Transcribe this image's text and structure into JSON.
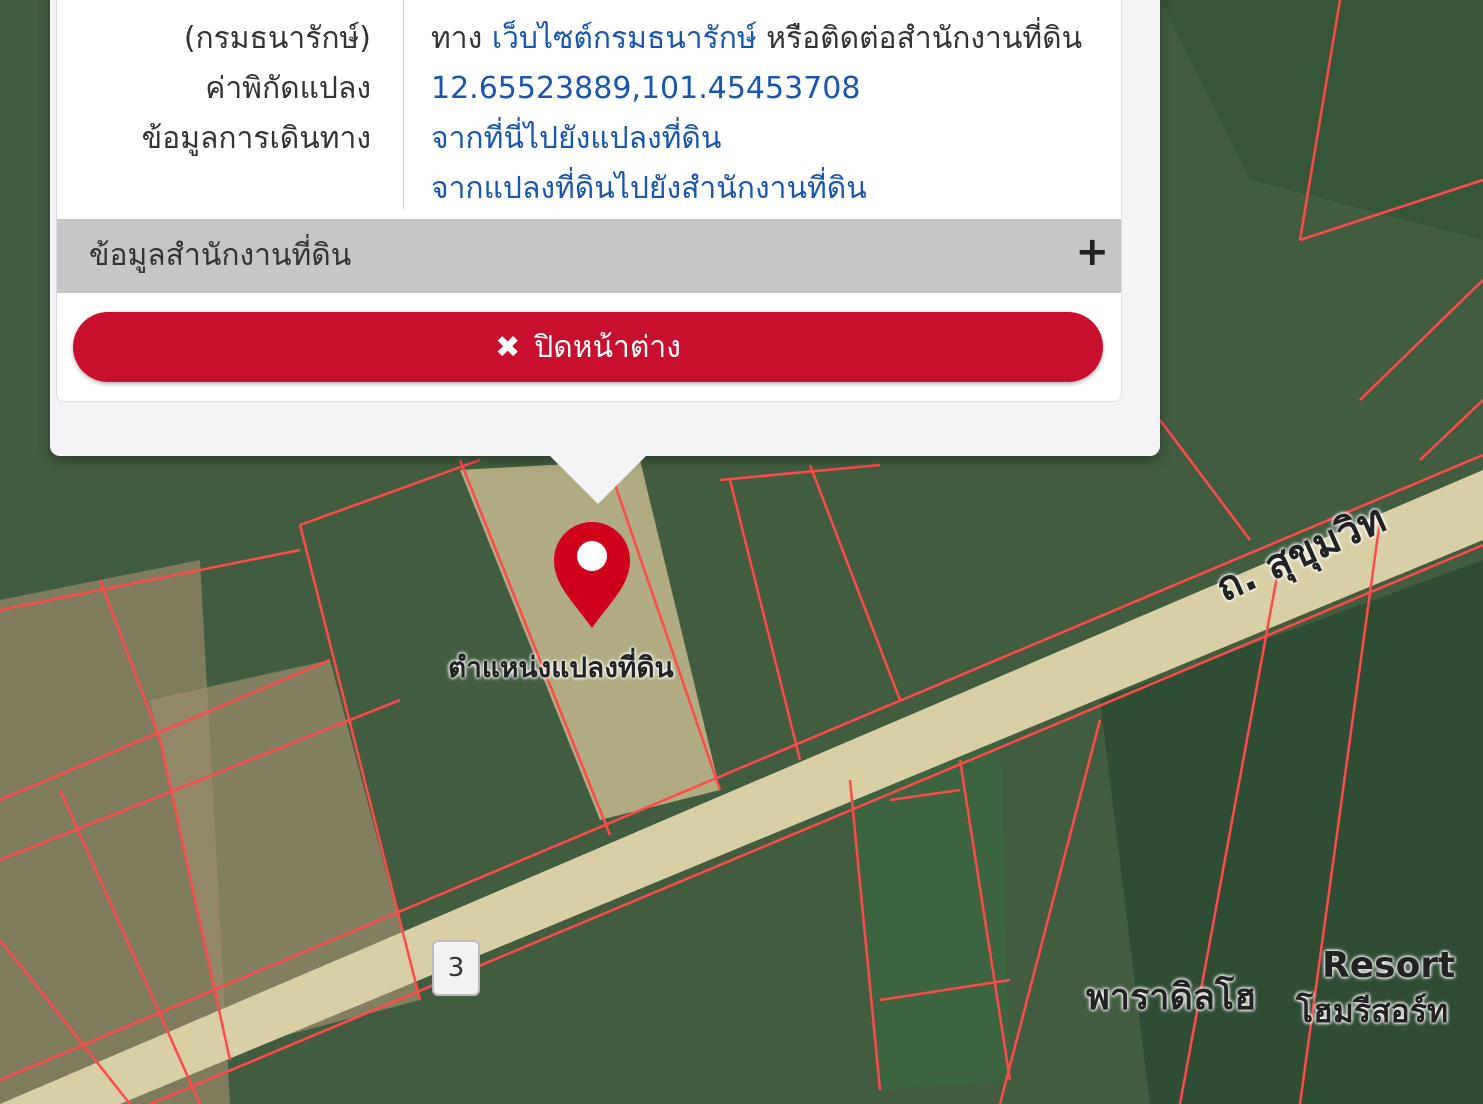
{
  "popup": {
    "rows": [
      {
        "label": "(กรมธนารักษ์)",
        "prefix": "ทาง ",
        "link": "เว็บไซต์กรมธนารักษ์",
        "suffix": " หรือติดต่อสำนักงานที่ดิน"
      },
      {
        "label": "ค่าพิกัดแปลง",
        "link": "12.65523889,101.45453708"
      },
      {
        "label": "ข้อมูลการเดินทาง",
        "link": "จากที่นี่ไปยังแปลงที่ดิน"
      },
      {
        "link": "จากแปลงที่ดินไปยังสำนักงานที่ดิน"
      }
    ],
    "section_label": "ข้อมูลสำนักงานที่ดิน",
    "close_label": "ปิดหน้าต่าง"
  },
  "map": {
    "marker_label": "ตำแหน่งแปลงที่ดิน",
    "road_label": "ถ. สุขุมวิท",
    "route_number": "3",
    "resort_label": "Resort",
    "resort_thai": "พาราดิลโฮ",
    "resort_thai_sub": "โฮมรีสอร์ท"
  },
  "colors": {
    "close_button": "#c8102e",
    "link": "#1856b0",
    "marker": "#d0021b",
    "parcel_line": "#ff4a4a"
  }
}
